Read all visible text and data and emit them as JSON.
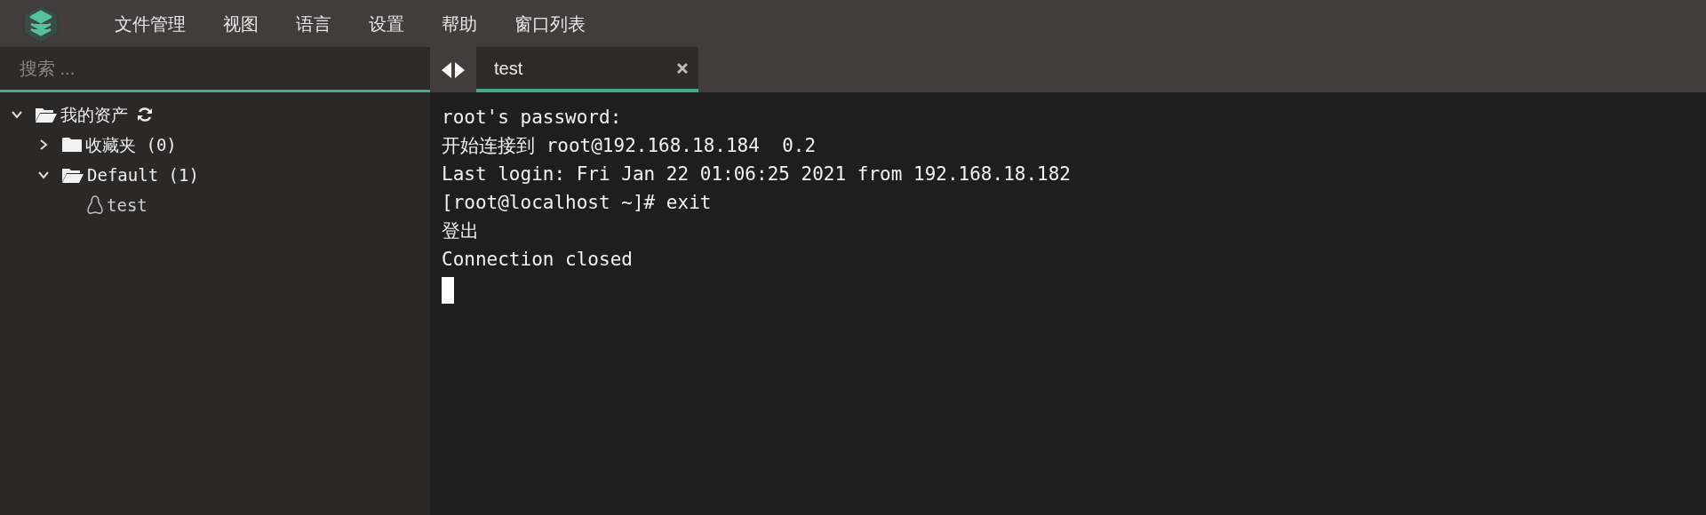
{
  "menu": [
    "文件管理",
    "视图",
    "语言",
    "设置",
    "帮助",
    "窗口列表"
  ],
  "search": {
    "placeholder": "搜索 ..."
  },
  "tree": [
    {
      "label": "我的资产",
      "kind": "root",
      "expanded": true,
      "children": [
        {
          "label": "收藏夹 (0)",
          "kind": "folder",
          "expanded": false
        },
        {
          "label": "Default (1)",
          "kind": "folder",
          "expanded": true,
          "children": [
            {
              "label": "test",
              "kind": "host"
            }
          ]
        }
      ]
    }
  ],
  "tabs": [
    {
      "label": "test",
      "selected": true
    }
  ],
  "terminal": {
    "lines": [
      "root's password:",
      "开始连接到 root@192.168.18.184  0.2",
      "Last login: Fri Jan 22 01:06:25 2021 from 192.168.18.182",
      "[root@localhost ~]# exit",
      "登出",
      "Connection closed"
    ],
    "cursor": true
  }
}
